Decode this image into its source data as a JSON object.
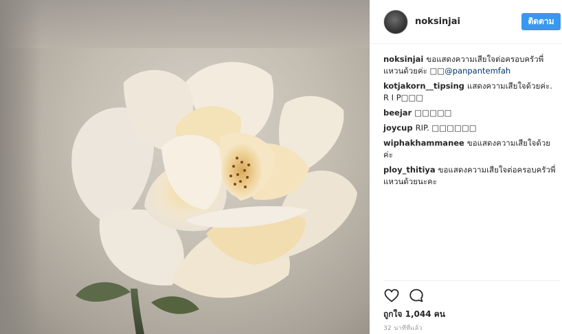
{
  "post": {
    "image_alt": "Cream-colored rose flower close-up",
    "icon": "rose-photo"
  },
  "header": {
    "username": "noksinjai",
    "follow_label": "ติดตาม",
    "avatar_icon": "avatar-icon"
  },
  "comments": [
    {
      "user": "noksinjai",
      "text": "ขอแสดงความเสียใจต่อครอบครัวพี่แหวนด้วยค่ะ □□",
      "mention": "@panpantemfah"
    },
    {
      "user": "kotjakorn__tipsing",
      "text": "แสดงความเสียใจด้วยค่ะ. R I P□□□",
      "mention": ""
    },
    {
      "user": "beejar",
      "text": "□□□□□",
      "mention": ""
    },
    {
      "user": "joycup",
      "text": "RIP. □□□□□□",
      "mention": ""
    },
    {
      "user": "wiphakhammanee",
      "text": "ขอแสดงความเสียใจด้วยค่ะ",
      "mention": ""
    },
    {
      "user": "ploy_thitiya",
      "text": "ขอแสดงความเสียใจต่อครอบครัวพี่แหวนด้วยนะคะ",
      "mention": ""
    }
  ],
  "actions": {
    "like_icon": "heart-icon",
    "comment_icon": "comment-icon",
    "likes_text": "ถูกใจ 1,044 คน",
    "time_text": "32 นาทีที่แล้ว"
  },
  "colors": {
    "follow_button": "#3897f0",
    "mention": "#003569",
    "muted": "#999999"
  }
}
